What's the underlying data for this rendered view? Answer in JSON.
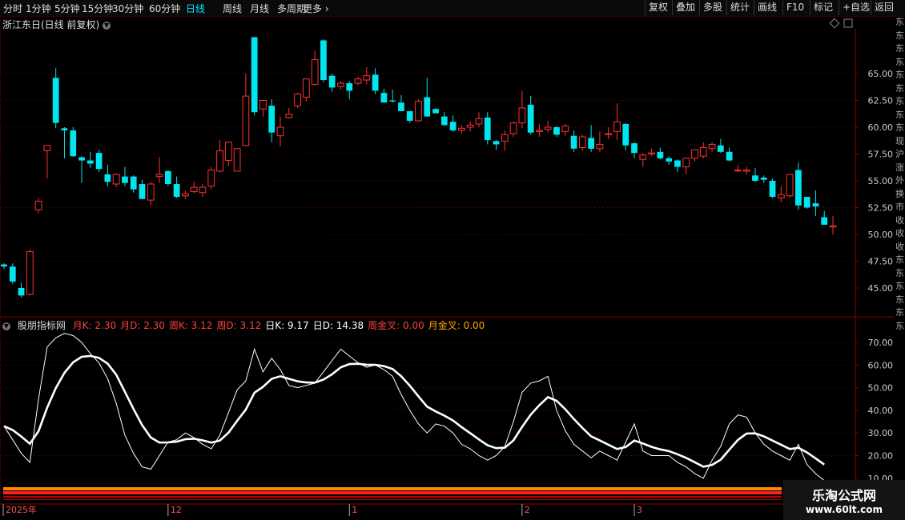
{
  "toolbar": {
    "periods": [
      "分时",
      "1分钟",
      "5分钟",
      "15分钟",
      "30分钟",
      "60分钟",
      "日线",
      "周线",
      "月线",
      "多周期",
      "更多"
    ],
    "active_period": "日线",
    "tools": [
      "复权",
      "叠加",
      "多股",
      "统计",
      "画线",
      "F10",
      "标记",
      "+自选",
      "返回"
    ]
  },
  "title": "浙江东日(日线 前复权)",
  "indicator": {
    "name": "股朋指标网",
    "values": [
      {
        "label": "月K: 2.30",
        "color": "#ff4040"
      },
      {
        "label": "月D: 2.30",
        "color": "#ff4040"
      },
      {
        "label": "周K: 3.12",
        "color": "#ff4040"
      },
      {
        "label": "周D: 3.12",
        "color": "#ff4040"
      },
      {
        "label": "日K: 9.17",
        "color": "#ffffff"
      },
      {
        "label": "日D: 14.38",
        "color": "#ffffff"
      },
      {
        "label": "周金叉: 0.00",
        "color": "#ff4040"
      },
      {
        "label": "月金叉: 0.00",
        "color": "#ffa500"
      }
    ]
  },
  "price_axis": [
    "65.00",
    "62.50",
    "60.00",
    "57.50",
    "55.00",
    "52.50",
    "50.00",
    "47.50",
    "45.00"
  ],
  "ind_axis": [
    "70.00",
    "60.00",
    "50.00",
    "40.00",
    "30.00",
    "20.00",
    "10.00"
  ],
  "date_axis": [
    {
      "label": "2025年",
      "idx": 0
    },
    {
      "label": "12",
      "idx": 19
    },
    {
      "label": "1",
      "idx": 40
    },
    {
      "label": "2",
      "idx": 60
    },
    {
      "label": "3",
      "idx": 73
    }
  ],
  "side_strip": "东东东东东东东东东现沪涨外换市收收收东东东东东东",
  "brand": {
    "line1": "乐淘公式网",
    "line2": "www.60lt.com"
  },
  "colors": {
    "up": "#ff3030",
    "down": "#00e5ee",
    "grid": "#4a0000",
    "axis_text": "#cccccc"
  },
  "chart_data": {
    "type": "candlestick",
    "candles": [
      [
        47.2,
        47.3,
        46.8,
        47.0
      ],
      [
        47.0,
        47.3,
        45.4,
        45.6
      ],
      [
        45.0,
        45.5,
        44.1,
        44.3
      ],
      [
        44.4,
        48.6,
        44.3,
        48.4
      ],
      [
        52.3,
        53.4,
        52.0,
        53.1
      ],
      [
        57.8,
        58.3,
        55.2,
        58.3
      ],
      [
        64.6,
        65.5,
        59.9,
        60.4
      ],
      [
        59.9,
        60.0,
        57.1,
        59.7
      ],
      [
        59.7,
        60.0,
        57.2,
        57.3
      ],
      [
        57.2,
        57.3,
        54.8,
        56.9
      ],
      [
        56.9,
        57.7,
        56.2,
        56.6
      ],
      [
        57.6,
        57.9,
        55.8,
        56.1
      ],
      [
        55.6,
        56.5,
        54.5,
        54.9
      ],
      [
        54.7,
        55.7,
        54.4,
        55.6
      ],
      [
        55.4,
        56.3,
        54.5,
        54.8
      ],
      [
        55.4,
        55.5,
        53.9,
        54.2
      ],
      [
        54.7,
        55.1,
        53.3,
        53.3
      ],
      [
        53.2,
        54.9,
        52.7,
        54.7
      ],
      [
        55.4,
        57.2,
        54.8,
        55.6
      ],
      [
        55.9,
        56.0,
        54.5,
        54.7
      ],
      [
        54.7,
        55.4,
        53.4,
        53.5
      ],
      [
        53.6,
        54.1,
        53.3,
        53.8
      ],
      [
        54.0,
        54.9,
        53.8,
        54.4
      ],
      [
        53.9,
        54.7,
        53.5,
        54.4
      ],
      [
        54.5,
        56.3,
        54.2,
        56.0
      ],
      [
        55.9,
        58.8,
        55.8,
        57.8
      ],
      [
        56.9,
        58.6,
        56.4,
        58.6
      ],
      [
        55.9,
        58.0,
        55.9,
        58.0
      ],
      [
        58.3,
        65.0,
        58.2,
        62.9
      ],
      [
        68.4,
        68.4,
        61.1,
        61.4
      ],
      [
        61.7,
        62.5,
        61.0,
        62.5
      ],
      [
        62.0,
        62.6,
        58.6,
        59.5
      ],
      [
        59.2,
        61.0,
        58.2,
        60.0
      ],
      [
        60.9,
        61.8,
        60.8,
        61.2
      ],
      [
        62.0,
        63.2,
        61.8,
        63.1
      ],
      [
        62.8,
        64.4,
        62.4,
        64.5
      ],
      [
        64.0,
        67.1,
        63.9,
        66.3
      ],
      [
        68.1,
        68.2,
        64.2,
        64.4
      ],
      [
        64.8,
        65.0,
        63.3,
        63.7
      ],
      [
        63.8,
        64.3,
        63.5,
        64.1
      ],
      [
        64.1,
        64.3,
        62.6,
        63.4
      ],
      [
        64.1,
        64.7,
        63.9,
        64.5
      ],
      [
        64.4,
        65.6,
        64.0,
        64.8
      ],
      [
        64.9,
        65.5,
        63.1,
        63.4
      ],
      [
        63.2,
        63.6,
        62.3,
        62.3
      ],
      [
        62.5,
        63.5,
        62.3,
        62.4
      ],
      [
        62.3,
        63.0,
        61.5,
        61.5
      ],
      [
        61.5,
        61.5,
        60.4,
        60.6
      ],
      [
        60.6,
        62.6,
        60.5,
        62.4
      ],
      [
        62.8,
        64.6,
        61.0,
        61.0
      ],
      [
        61.7,
        61.8,
        61.3,
        61.3
      ],
      [
        61.0,
        61.4,
        60.1,
        60.2
      ],
      [
        60.5,
        61.1,
        59.6,
        59.7
      ],
      [
        59.7,
        60.2,
        59.4,
        59.9
      ],
      [
        60.0,
        60.5,
        59.6,
        60.2
      ],
      [
        60.3,
        61.4,
        60.0,
        60.8
      ],
      [
        60.9,
        61.4,
        58.4,
        58.8
      ],
      [
        58.7,
        58.8,
        57.9,
        58.4
      ],
      [
        58.7,
        59.7,
        57.8,
        59.3
      ],
      [
        59.4,
        60.5,
        59.1,
        60.4
      ],
      [
        60.4,
        63.4,
        59.9,
        61.8
      ],
      [
        62.1,
        62.9,
        59.3,
        59.5
      ],
      [
        59.6,
        60.3,
        59.1,
        59.7
      ],
      [
        59.8,
        60.6,
        59.5,
        60.0
      ],
      [
        60.0,
        60.1,
        59.1,
        59.3
      ],
      [
        59.6,
        60.3,
        59.2,
        60.1
      ],
      [
        59.2,
        59.7,
        57.7,
        58.0
      ],
      [
        58.1,
        59.3,
        57.8,
        59.1
      ],
      [
        59.0,
        60.2,
        57.7,
        58.0
      ],
      [
        58.0,
        59.6,
        57.7,
        58.4
      ],
      [
        59.3,
        60.0,
        58.9,
        59.4
      ],
      [
        59.6,
        62.2,
        58.8,
        60.5
      ],
      [
        60.3,
        60.4,
        57.8,
        58.3
      ],
      [
        58.5,
        58.6,
        57.1,
        57.6
      ],
      [
        57.0,
        57.6,
        56.3,
        57.4
      ],
      [
        57.5,
        58.0,
        57.3,
        57.6
      ],
      [
        57.7,
        58.1,
        57.0,
        57.1
      ],
      [
        57.1,
        57.3,
        56.5,
        56.8
      ],
      [
        56.9,
        57.0,
        55.8,
        56.3
      ],
      [
        56.3,
        56.7,
        55.6,
        57.1
      ],
      [
        57.1,
        57.3,
        56.8,
        57.9
      ],
      [
        57.3,
        58.6,
        57.1,
        58.1
      ],
      [
        58.0,
        58.6,
        57.7,
        58.4
      ],
      [
        58.3,
        58.9,
        57.6,
        57.7
      ],
      [
        57.7,
        58.1,
        56.8,
        56.9
      ],
      [
        56.0,
        56.5,
        55.8,
        56.0
      ],
      [
        55.9,
        56.3,
        55.6,
        56.0
      ],
      [
        55.5,
        56.2,
        54.9,
        55.0
      ],
      [
        55.3,
        55.5,
        54.8,
        55.1
      ],
      [
        55.0,
        55.2,
        53.4,
        53.5
      ],
      [
        53.4,
        54.5,
        53.0,
        53.7
      ],
      [
        53.6,
        55.3,
        53.4,
        55.6
      ],
      [
        56.0,
        56.7,
        52.3,
        52.7
      ],
      [
        53.5,
        53.5,
        52.4,
        52.5
      ],
      [
        52.9,
        54.1,
        51.7,
        52.6
      ],
      [
        51.6,
        52.2,
        50.9,
        50.9
      ],
      [
        50.7,
        51.7,
        50.0,
        50.8
      ]
    ],
    "kdj_k": [
      33,
      27,
      21,
      17,
      45,
      68,
      72,
      74,
      73,
      70,
      65,
      61,
      54,
      43,
      29,
      21,
      15,
      14,
      20,
      26,
      27,
      30,
      28,
      25,
      23,
      29,
      39,
      49,
      53,
      67,
      57,
      63,
      58,
      51,
      50,
      51,
      52,
      57,
      62,
      67,
      64,
      61,
      59,
      60,
      58,
      55,
      47,
      40,
      34,
      30,
      34,
      33,
      30,
      25,
      23,
      20,
      18,
      20,
      24,
      35,
      48,
      52,
      53,
      55,
      40,
      31,
      25,
      22,
      19,
      22,
      20,
      18,
      26,
      34,
      22,
      20,
      20,
      20,
      17,
      15,
      12,
      10,
      18,
      24,
      34,
      38,
      37,
      30,
      25,
      22,
      20,
      18,
      25,
      16,
      12,
      9
    ]
  }
}
